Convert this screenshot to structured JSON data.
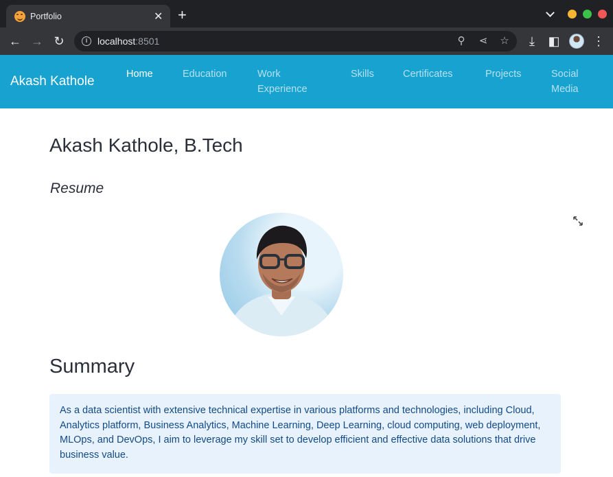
{
  "browser": {
    "tab_title": "Portfolio",
    "url_host": "localhost",
    "url_port": ":8501"
  },
  "navbar": {
    "brand": "Akash Kathole",
    "items": [
      {
        "label": "Home",
        "active": true
      },
      {
        "label": "Education",
        "active": false
      },
      {
        "label": "Work",
        "active": false
      },
      {
        "label": "Experience",
        "active": false
      },
      {
        "label": "Skills",
        "active": false
      },
      {
        "label": "Certificates",
        "active": false
      },
      {
        "label": "Projects",
        "active": false
      },
      {
        "label": "Social",
        "active": false
      },
      {
        "label": "Media",
        "active": false
      }
    ]
  },
  "main": {
    "title": "Akash Kathole, B.Tech",
    "resume_label": "Resume",
    "summary_heading": "Summary",
    "summary_text": "As a data scientist with extensive technical expertise in various platforms and technologies, including Cloud, Analytics platform, Business Analytics, Machine Learning, Deep Learning, cloud computing, web deployment, MLOps, and DevOps, I aim to leverage my skill set to develop efficient and effective data solutions that drive business value."
  },
  "colors": {
    "navbar_bg": "#17a2d0",
    "summary_bg": "#e8f2fc",
    "summary_text": "#124a86"
  }
}
